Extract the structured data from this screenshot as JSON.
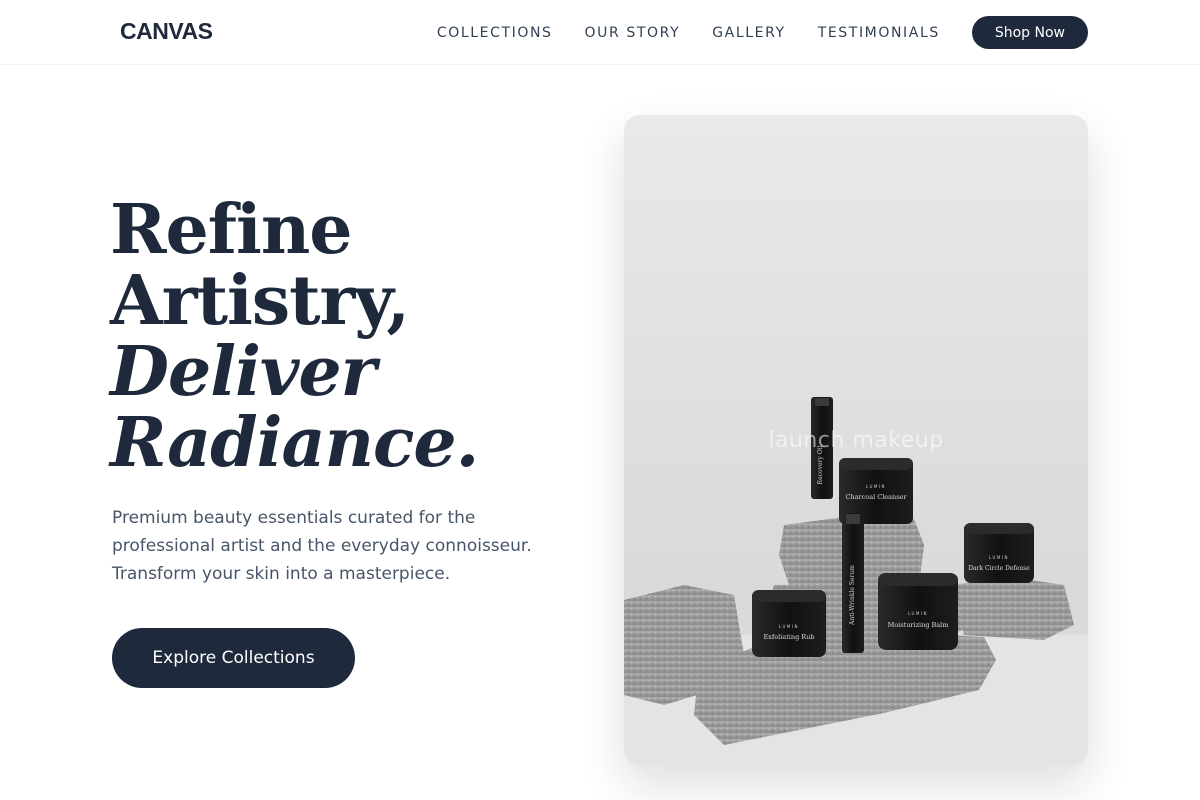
{
  "header": {
    "logo": "CANVAS",
    "nav": [
      "COLLECTIONS",
      "OUR STORY",
      "GALLERY",
      "TESTIMONIALS"
    ],
    "cta": "Shop Now"
  },
  "hero": {
    "headline": [
      "Refine",
      "Artistry,",
      "Deliver",
      "Radiance."
    ],
    "subtext": [
      "Premium beauty essentials curated for the",
      "professional artist and the everyday connoisseur.",
      "Transform your skin into a masterpiece."
    ],
    "cta": "Explore Collections",
    "image": {
      "watermark": "launch makeup",
      "brand_mark": "LUMIN",
      "product_labels": [
        "Recovery Oil",
        "Charcoal Cleanser",
        "Anti-Wrinkle Serum",
        "Exfoliating Rub",
        "Moisturizing Balm",
        "Dark Circle Defense"
      ]
    }
  },
  "colors": {
    "primary": "#1e293b",
    "text_muted": "#475569",
    "background": "#ffffff"
  }
}
